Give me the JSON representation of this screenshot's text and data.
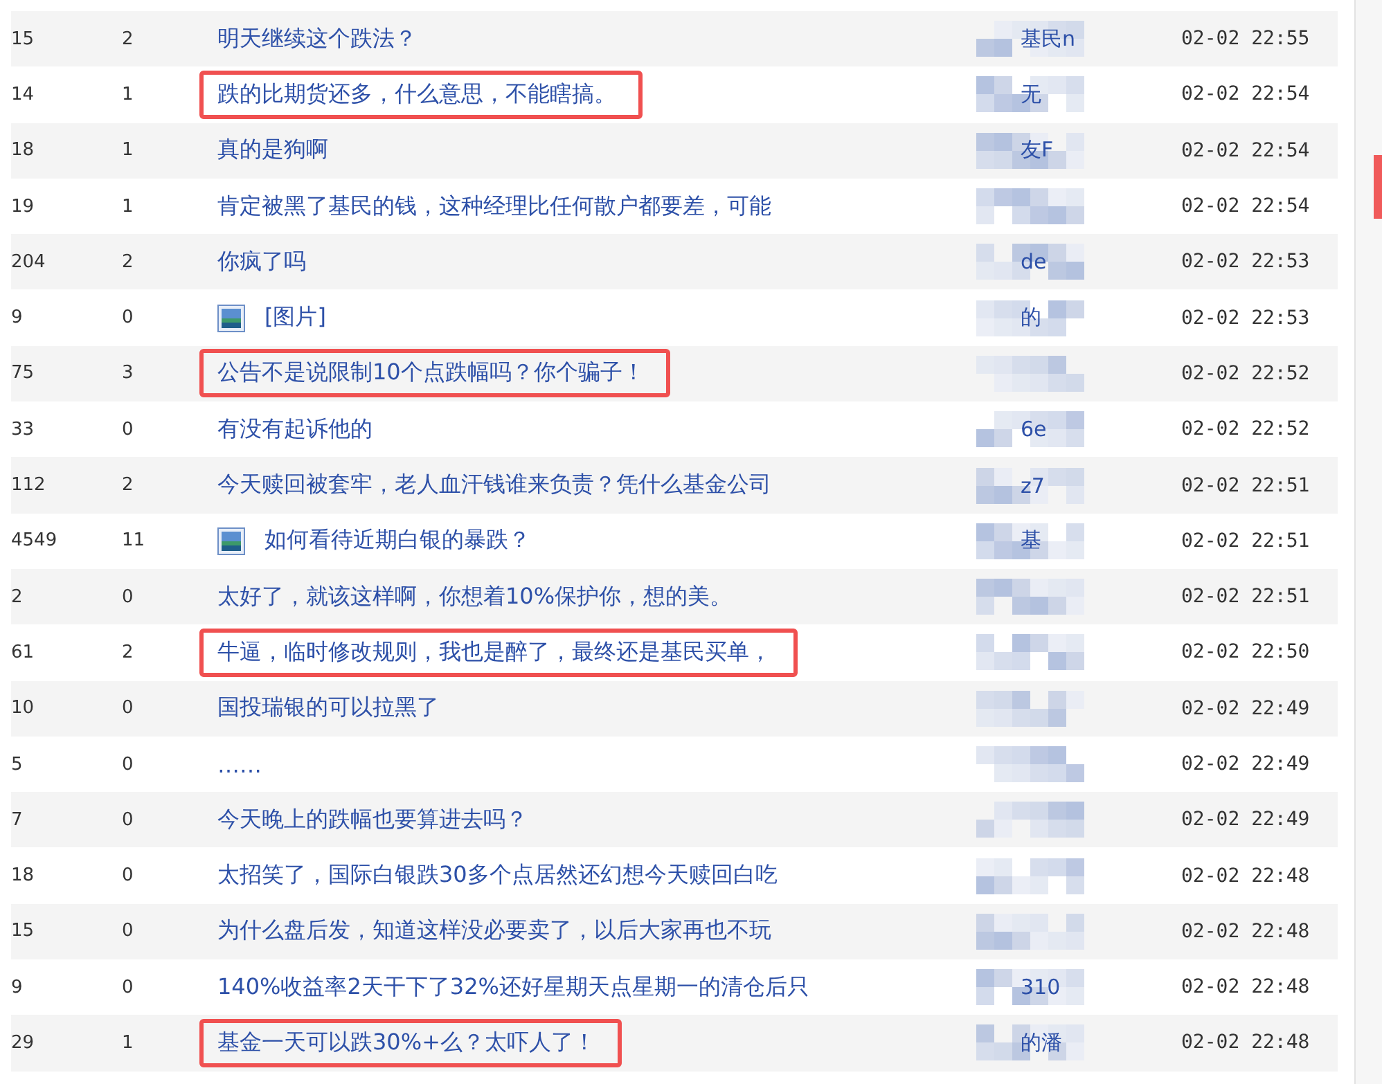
{
  "posts": [
    {
      "reads": "15",
      "replies": "2",
      "title": "明天继续这个跌法？",
      "has_image": false,
      "highlighted": false,
      "author_fragment": "基民n",
      "time": "02-02 22:55"
    },
    {
      "reads": "14",
      "replies": "1",
      "title": "跌的比期货还多，什么意思，不能瞎搞。",
      "has_image": false,
      "highlighted": true,
      "author_fragment": "无",
      "time": "02-02 22:54"
    },
    {
      "reads": "18",
      "replies": "1",
      "title": "真的是狗啊",
      "has_image": false,
      "highlighted": false,
      "author_fragment": "友F",
      "time": "02-02 22:54"
    },
    {
      "reads": "19",
      "replies": "1",
      "title": "肯定被黑了基民的钱，这种经理比任何散户都要差，可能",
      "has_image": false,
      "highlighted": false,
      "time": "02-02 22:54"
    },
    {
      "reads": "204",
      "replies": "2",
      "title": "你疯了吗",
      "has_image": false,
      "highlighted": false,
      "author_fragment": "de",
      "time": "02-02 22:53"
    },
    {
      "reads": "9",
      "replies": "0",
      "title": "[图片]",
      "has_image": true,
      "highlighted": false,
      "author_fragment": "的",
      "time": "02-02 22:53"
    },
    {
      "reads": "75",
      "replies": "3",
      "title": "公告不是说限制10个点跌幅吗？你个骗子！",
      "has_image": false,
      "highlighted": true,
      "time": "02-02 22:52"
    },
    {
      "reads": "33",
      "replies": "0",
      "title": "有没有起诉他的",
      "has_image": false,
      "highlighted": false,
      "author_fragment": "6e",
      "time": "02-02 22:52"
    },
    {
      "reads": "112",
      "replies": "2",
      "title": "今天赎回被套牢，老人血汗钱谁来负责？凭什么基金公司",
      "has_image": false,
      "highlighted": false,
      "author_fragment": "z7",
      "time": "02-02 22:51"
    },
    {
      "reads": "4549",
      "replies": "11",
      "title": "如何看待近期白银的暴跌？",
      "has_image": true,
      "highlighted": false,
      "author_fragment": "基",
      "time": "02-02 22:51"
    },
    {
      "reads": "2",
      "replies": "0",
      "title": "太好了，就该这样啊，你想着10%保护你，想的美。",
      "has_image": false,
      "highlighted": false,
      "time": "02-02 22:51"
    },
    {
      "reads": "61",
      "replies": "2",
      "title": "牛逼，临时修改规则，我也是醉了，最终还是基民买单，",
      "has_image": false,
      "highlighted": true,
      "time": "02-02 22:50"
    },
    {
      "reads": "10",
      "replies": "0",
      "title": "国投瑞银的可以拉黑了",
      "has_image": false,
      "highlighted": false,
      "time": "02-02 22:49"
    },
    {
      "reads": "5",
      "replies": "0",
      "title": "……",
      "has_image": false,
      "highlighted": false,
      "time": "02-02 22:49"
    },
    {
      "reads": "7",
      "replies": "0",
      "title": "今天晚上的跌幅也要算进去吗？",
      "has_image": false,
      "highlighted": false,
      "time": "02-02 22:49"
    },
    {
      "reads": "18",
      "replies": "0",
      "title": "太招笑了，国际白银跌30多个点居然还幻想今天赎回白吃",
      "has_image": false,
      "highlighted": false,
      "time": "02-02 22:48"
    },
    {
      "reads": "15",
      "replies": "0",
      "title": "为什么盘后发，知道这样没必要卖了，以后大家再也不玩",
      "has_image": false,
      "highlighted": false,
      "time": "02-02 22:48"
    },
    {
      "reads": "9",
      "replies": "0",
      "title": "140%收益率2天干下了32%还好星期天点星期一的清仓后只",
      "has_image": false,
      "highlighted": false,
      "author_fragment": "310",
      "time": "02-02 22:48"
    },
    {
      "reads": "29",
      "replies": "1",
      "title": "基金一天可以跌30%+么？太吓人了！",
      "has_image": false,
      "highlighted": true,
      "author_fragment": "的潘",
      "time": "02-02 22:48"
    }
  ]
}
